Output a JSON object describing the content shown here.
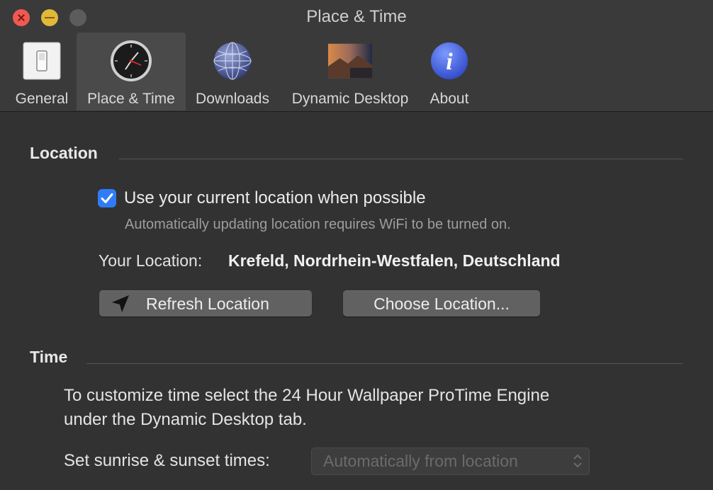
{
  "window": {
    "title": "Place & Time"
  },
  "tabs": [
    {
      "label": "General",
      "icon": "switch-icon"
    },
    {
      "label": "Place & Time",
      "icon": "clock-icon"
    },
    {
      "label": "Downloads",
      "icon": "globe-icon"
    },
    {
      "label": "Dynamic Desktop",
      "icon": "desktop-wallpaper-icon"
    },
    {
      "label": "About",
      "icon": "info-icon"
    }
  ],
  "location": {
    "title": "Location",
    "use_current_label": "Use your current location when possible",
    "use_current_checked": true,
    "hint": "Automatically updating location requires WiFi to be turned on.",
    "your_location_label": "Your Location:",
    "your_location_value": "Krefeld, Nordrhein-Westfalen, Deutschland",
    "refresh_button": "Refresh Location",
    "choose_button": "Choose Location..."
  },
  "time": {
    "title": "Time",
    "description_line1": "To customize time select the 24 Hour Wallpaper ProTime Engine",
    "description_line2": "under the Dynamic Desktop tab.",
    "sunrise_label": "Set sunrise & sunset times:",
    "sunrise_value": "Automatically from location"
  },
  "colors": {
    "accent": "#2f7cf6",
    "background": "#323232",
    "toolbar": "#3a3a3a"
  }
}
